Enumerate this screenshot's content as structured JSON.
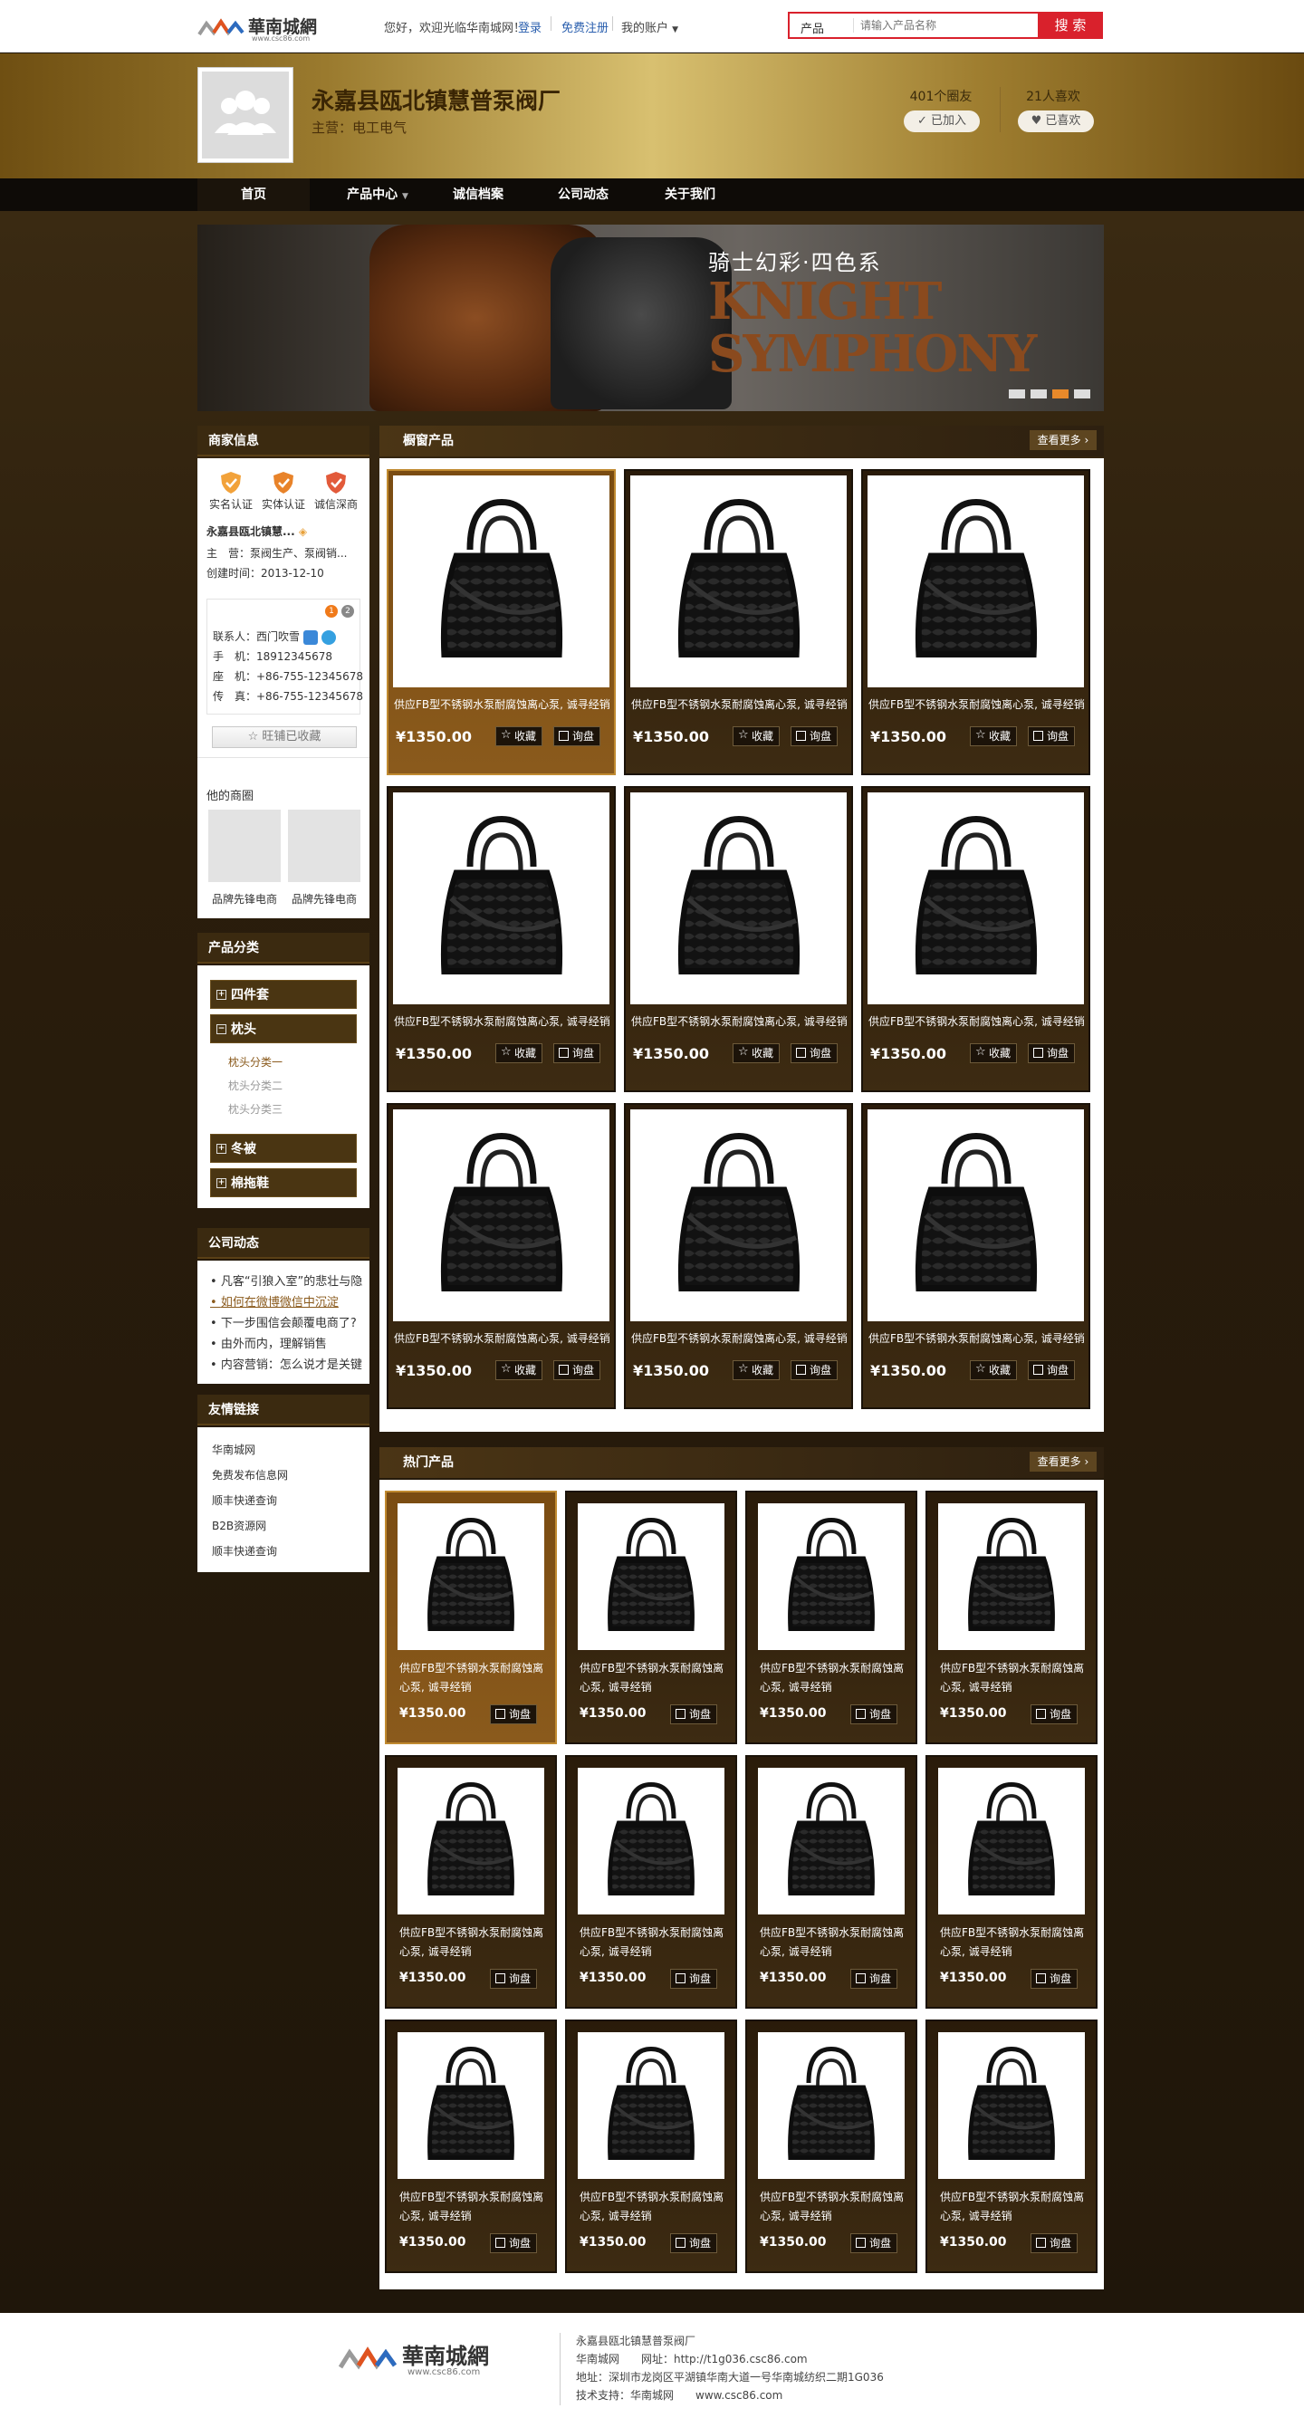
{
  "topbar": {
    "greeting": "您好，欢迎光临华南城网！",
    "login": "登录",
    "register": "免费注册",
    "account": "我的账户",
    "search_category": "产品",
    "search_placeholder": "请输入产品名称",
    "search_button": "搜 索"
  },
  "logo": {
    "site_name": "華南城網",
    "url_text": "www.csc86.com"
  },
  "shop": {
    "company": "永嘉县瓯北镇慧普泵阀厂",
    "main_business": "主营：电工电气",
    "friends_count": "401个圈友",
    "joined_button": "已加入",
    "likes_count": "21人喜欢",
    "liked_button": "已喜欢"
  },
  "nav": {
    "items": [
      "首页",
      "产品中心",
      "诚信档案",
      "公司动态",
      "关于我们"
    ]
  },
  "banner": {
    "subtitle": "骑士幻彩·四色系",
    "title_line1": "KNIGHT",
    "title_line2": "SYMPHONY",
    "slide_count": 4,
    "active_slide": 3
  },
  "merchant": {
    "heading": "商家信息",
    "badges": [
      "实名认证",
      "实体认证",
      "诚信深商"
    ],
    "name_short": "永嘉县瓯北镇慧...",
    "main_biz": "主　营：泵阀生产、泵阀销...",
    "created": "创建时间：2013-12-10",
    "contact_person": "联系人：西门吹雪",
    "mobile": "手　机：18912345678",
    "phone": "座　机：+86-755-12345678",
    "fax": "传　真：+86-755-12345678",
    "fav_button": "旺铺已收藏",
    "other_shops_heading": "他的商圈",
    "other_shops": [
      "品牌先锋电商",
      "品牌先锋电商"
    ]
  },
  "categories": {
    "heading": "产品分类",
    "items": [
      "四件套",
      "枕头",
      "冬被",
      "棉拖鞋"
    ],
    "subitems": [
      "枕头分类一",
      "枕头分类二",
      "枕头分类三"
    ]
  },
  "news": {
    "heading": "公司动态",
    "items": [
      "凡客“引狼入室”的悲壮与隐",
      "如何在微博微信中沉淀",
      "下一步围信会颠覆电商了?",
      "由外而内，理解销售",
      "内容营销：怎么说才是关键"
    ]
  },
  "links": {
    "heading": "友情链接",
    "items": [
      "华南城网",
      "免费发布信息网",
      "顺丰快递查询",
      "B2B资源网",
      "顺丰快递查询"
    ]
  },
  "window_products": {
    "heading": "橱窗产品",
    "more": "查看更多",
    "title": "供应FB型不锈钢水泵耐腐蚀离心泵, 诚寻经销",
    "price": "¥1350.00",
    "collect": "收藏",
    "inquire": "询盘"
  },
  "hot_products": {
    "heading": "热门产品",
    "more": "查看更多",
    "title": "供应FB型不锈钢水泵耐腐蚀离心泵, 诚寻经销",
    "price": "¥1350.00",
    "inquire": "询盘"
  },
  "footer": {
    "company": "永嘉县瓯北镇慧普泵阀厂",
    "site": "华南城网　　网址：http://t1g036.csc86.com",
    "address": "地址：深圳市龙岗区平湖镇华南大道一号华南城纺织二期1G036",
    "support": "技术支持：华南城网　　www.csc86.com"
  },
  "colors": {
    "accent_red": "#d9212c",
    "gold": "#9a7a2e",
    "dark_brown": "#241a0d"
  }
}
